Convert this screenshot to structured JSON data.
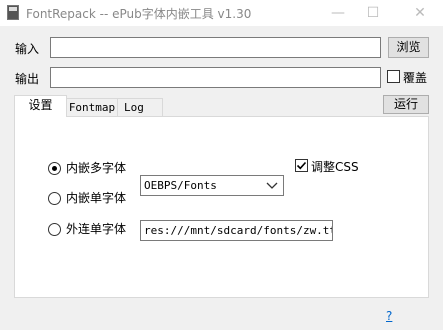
{
  "window": {
    "title": "FontRepack -- ePub字体内嵌工具 v1.30",
    "minimize_glyph": "—",
    "maximize_glyph": "☐",
    "close_glyph": "✕"
  },
  "input_row": {
    "label": "输入",
    "value": "",
    "browse_label": "浏览"
  },
  "output_row": {
    "label": "输出",
    "value": "",
    "overwrite_label": "覆盖",
    "overwrite_checked": false
  },
  "run_label": "运行",
  "tabs": [
    {
      "label": "设置",
      "active": true
    },
    {
      "label": "Fontmap",
      "active": false
    },
    {
      "label": "Log",
      "active": false
    }
  ],
  "settings": {
    "options": [
      {
        "label": "内嵌多字体",
        "selected": true
      },
      {
        "label": "内嵌单字体",
        "selected": false
      },
      {
        "label": "外连单字体",
        "selected": false
      }
    ],
    "font_select": {
      "value": "OEBPS/Fonts"
    },
    "external_font_path": "res:///mnt/sdcard/fonts/zw.ttf",
    "adjust_css": {
      "label": "调整CSS",
      "checked": true
    }
  },
  "help_link": "?",
  "icons": {
    "app": "book-app-icon",
    "dropdown": "chevron-down-icon",
    "check": "checkmark-icon"
  }
}
